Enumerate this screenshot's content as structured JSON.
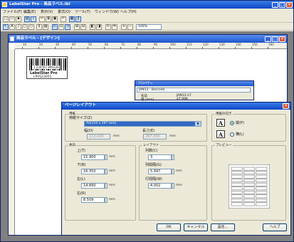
{
  "app": {
    "title": "LabelStar Pro - 商品ラベル.lbl",
    "logo_icon": "labelstar-logo-icon"
  },
  "menu": [
    "ファイル(F)",
    "編集(E)",
    "表示(V)",
    "書式(O)",
    "ツール(T)",
    "ウィンドウ(W)",
    "ヘルプ(H)"
  ],
  "toolbar": {
    "zoom_value": "100%"
  },
  "document": {
    "title": "商品ラベル - [デザイン]",
    "ruler_numbers": [
      "10",
      "20",
      "30",
      "40",
      "50",
      "60",
      "70",
      "80",
      "90",
      "100",
      "110",
      "120",
      "130",
      "140",
      "150",
      "160"
    ]
  },
  "label_preview": {
    "barcode_text": "1 234567 890128",
    "big_text": "LabelStar Pro",
    "code_text": "LPVS23051"
  },
  "properties": {
    "title": "プロパティ",
    "selected_object": "JAN13 - Barcode",
    "rows": [
      {
        "name": "名前",
        "value": "JAN13-17"
      },
      {
        "name": "幅 (mm)",
        "value": "47.998"
      }
    ]
  },
  "dialog": {
    "title": "ページレイアウト",
    "paper": {
      "group_title": "用紙",
      "size_label": "用紙サイズ(Z)",
      "size_value": "A4(210 x 297 mm)",
      "width_label": "幅(D)",
      "width_value": "210.000",
      "height_label": "長さ(E)",
      "height_value": "297.000",
      "unit": "mm"
    },
    "orientation": {
      "group_title": "用紙の向き",
      "icon_letter": "A",
      "portrait_label": "縦(P)",
      "landscape_label": "横(L)",
      "selected": "portrait"
    },
    "margins": {
      "group_title": "余白",
      "top_label": "上(T)",
      "top_value": "15.900",
      "bottom_label": "下(B)",
      "bottom_value": "16.350",
      "left_label": "左(L)",
      "left_value": "14.890",
      "right_label": "右(R)",
      "right_value": "8.509",
      "unit": "mm"
    },
    "layout": {
      "group_title": "レイアウト",
      "columns_label": "列数(C)",
      "columns_value": "3",
      "col_gap_label": "列間隔(G)",
      "col_gap_value": "5.997",
      "row_gap_label": "行間隔(W)",
      "row_gap_value": "4.002",
      "unit": "mm"
    },
    "preview": {
      "group_title": "プレビュー",
      "columns": 3,
      "rows": 10
    },
    "buttons": {
      "ok": "OK",
      "cancel": "キャンセル",
      "setup": "設定...",
      "help": "ヘルプ"
    }
  },
  "colors": {
    "background": "#efc050",
    "titlebar": "#0b47c5",
    "close_button": "#d9532c",
    "dialog_face": "#ece9d8"
  }
}
